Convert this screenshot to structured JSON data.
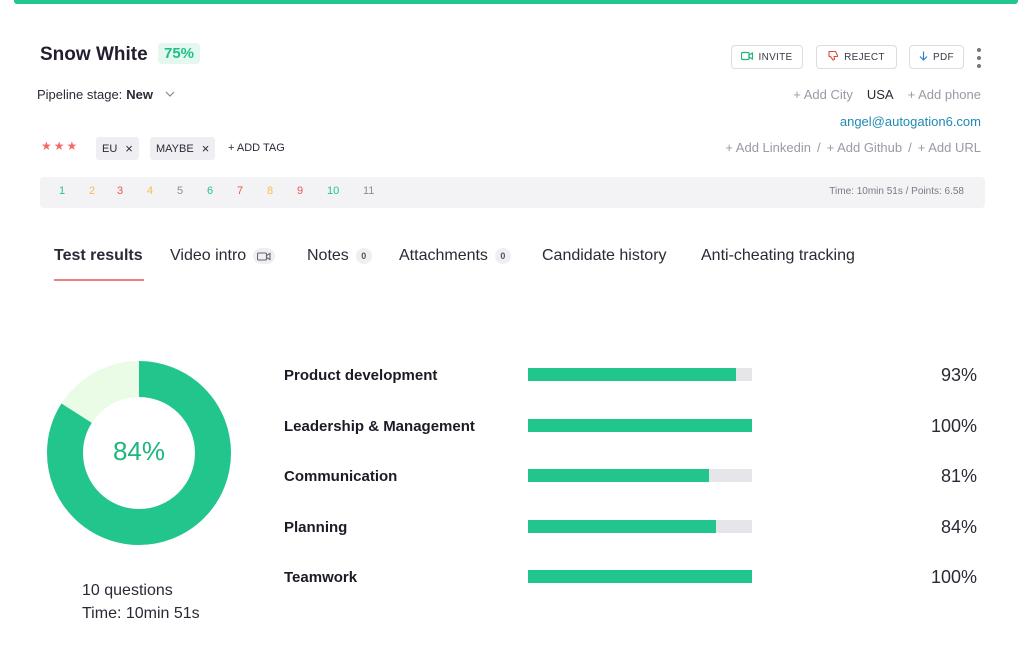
{
  "candidate": {
    "name": "Snow White",
    "score": "75%"
  },
  "actions": {
    "invite": "INVITE",
    "reject": "REJECT",
    "pdf": "PDF"
  },
  "pipeline": {
    "label": "Pipeline stage:",
    "value": "New"
  },
  "contact": {
    "add_city": "+ Add City",
    "country": "USA",
    "add_phone": "+ Add phone",
    "email": "angel@autogation6.com",
    "add_linkedin": "+ Add Linkedin",
    "add_github": "+ Add Github",
    "add_url": "+ Add URL",
    "separator": "/"
  },
  "rating": {
    "stars": 3,
    "star_color": "#ef6b6b"
  },
  "tags": [
    {
      "label": "EU"
    },
    {
      "label": "MAYBE"
    }
  ],
  "add_tag": "+ ADD TAG",
  "questions": [
    {
      "label": "1",
      "color": "#22c58b"
    },
    {
      "label": "2",
      "color": "#f5c14b"
    },
    {
      "label": "3",
      "color": "#e8564f"
    },
    {
      "label": "4",
      "color": "#f5c14b"
    },
    {
      "label": "5",
      "color": "#8c8c96"
    },
    {
      "label": "6",
      "color": "#22c58b"
    },
    {
      "label": "7",
      "color": "#e8564f"
    },
    {
      "label": "8",
      "color": "#f5c14b"
    },
    {
      "label": "9",
      "color": "#e8564f"
    },
    {
      "label": "10",
      "color": "#22c58b"
    },
    {
      "label": "11",
      "color": "#8c8c96"
    }
  ],
  "time_points": "Time: 10min 51s / Points: 6.58",
  "tabs": [
    {
      "label": "Test results",
      "active": true
    },
    {
      "label": "Video intro",
      "icon": "video-camera-icon"
    },
    {
      "label": "Notes",
      "count": "0"
    },
    {
      "label": "Attachments",
      "count": "0"
    },
    {
      "label": "Candidate history"
    },
    {
      "label": "Anti-cheating tracking"
    }
  ],
  "summary": {
    "percent_label": "84%",
    "percent_value": 84,
    "questions": "10 questions",
    "time": "Time: 10min 51s"
  },
  "skills": [
    {
      "name": "Product development",
      "value": 93,
      "label": "93%"
    },
    {
      "name": "Leadership & Management",
      "value": 100,
      "label": "100%"
    },
    {
      "name": "Communication",
      "value": 81,
      "label": "81%"
    },
    {
      "name": "Planning",
      "value": 84,
      "label": "84%"
    },
    {
      "name": "Teamwork",
      "value": 100,
      "label": "100%"
    }
  ],
  "colors": {
    "accent": "#22c58b",
    "donut_rest": "#eafbe6",
    "track": "#e6e6ea",
    "tab_underline": "#e8847c"
  }
}
